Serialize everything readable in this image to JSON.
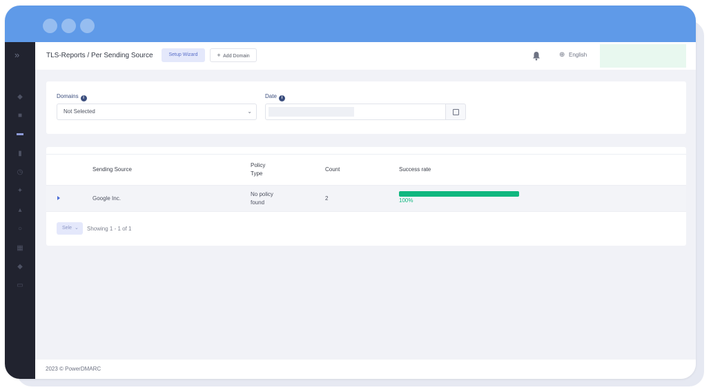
{
  "header": {
    "breadcrumb": "TLS-Reports / Per Sending Source",
    "setup_wizard_label": "Setup Wizard",
    "add_domain_label": "Add Domain",
    "add_domain_icon": "+",
    "language": "English"
  },
  "filters": {
    "domains_label": "Domains",
    "domains_value": "Not Selected",
    "date_label": "Date",
    "info_icon": "i"
  },
  "table": {
    "columns": {
      "sending_source": "Sending Source",
      "policy_type_line1": "Policy",
      "policy_type_line2": "Type",
      "count": "Count",
      "success_rate": "Success rate"
    },
    "rows": [
      {
        "sending_source": "Google Inc.",
        "policy_line1": "No policy",
        "policy_line2": "found",
        "count": "2",
        "success_rate_text": "100%",
        "success_rate": 1.0
      }
    ]
  },
  "pagination": {
    "page_size_label": "Sele",
    "showing": "Showing 1 - 1 of 1"
  },
  "footer": {
    "copyright": "2023 © PowerDMARC"
  },
  "colors": {
    "titlebar": "#5f9ae8",
    "sidebar": "#21232f",
    "success": "#10b77f",
    "accent": "#5a6fc9"
  }
}
